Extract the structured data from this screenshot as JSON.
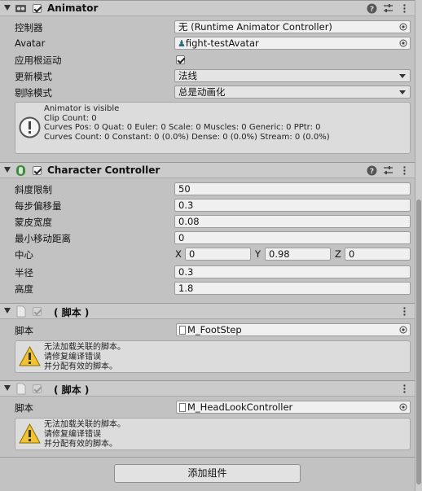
{
  "animator": {
    "title": "Animator",
    "fields": [
      {
        "label": "控制器",
        "value": "无 (Runtime Animator Controller)"
      },
      {
        "label": "Avatar",
        "value": "fight-testAvatar"
      },
      {
        "label": "应用根运动",
        "checked": true
      },
      {
        "label": "更新模式",
        "value": "法线"
      },
      {
        "label": "剔除模式",
        "value": "总是动画化"
      }
    ],
    "info_lines": [
      "Animator is visible",
      "Clip Count: 0",
      "Curves Pos: 0 Quat: 0 Euler: 0 Scale: 0 Muscles: 0 Generic: 0 PPtr: 0",
      "Curves Count: 0 Constant: 0 (0.0%) Dense: 0 (0.0%) Stream: 0 (0.0%)"
    ]
  },
  "character_controller": {
    "title": "Character Controller",
    "fields": [
      {
        "label": "斜度限制",
        "value": "50"
      },
      {
        "label": "每步偏移量",
        "value": "0.3"
      },
      {
        "label": "蒙皮宽度",
        "value": "0.08"
      },
      {
        "label": "最小移动距离",
        "value": "0"
      },
      {
        "label": "中心",
        "x_label": "X",
        "x": "0",
        "y_label": "Y",
        "y": "0.98",
        "z_label": "Z",
        "z": "0"
      },
      {
        "label": "半径",
        "value": "0.3"
      },
      {
        "label": "高度",
        "value": "1.8"
      }
    ]
  },
  "scripts": [
    {
      "title": "( 脚本 )",
      "field_label": "脚本",
      "value": "M_FootStep",
      "warning_lines": [
        "无法加载关联的脚本。",
        "请修复编译错误",
        "并分配有效的脚本。"
      ]
    },
    {
      "title": "( 脚本 )",
      "field_label": "脚本",
      "value": "M_HeadLookController",
      "warning_lines": [
        "无法加载关联的脚本。",
        "请修复编译错误",
        "并分配有效的脚本。"
      ]
    }
  ],
  "add_component_label": "添加组件",
  "colors": {
    "panel": "#c2c2c2",
    "header": "#cbcbcb",
    "field": "#f0f0f0",
    "warning": "#f1c232"
  }
}
